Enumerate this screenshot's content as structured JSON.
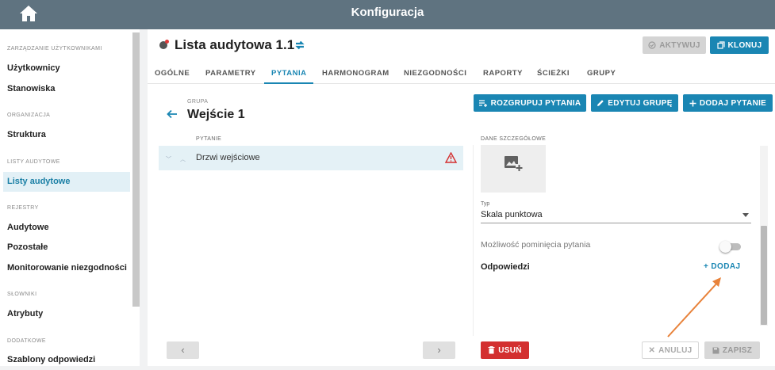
{
  "header": {
    "title": "Konfiguracja",
    "home_icon": "home-icon"
  },
  "sidebar": {
    "sections": [
      {
        "title": "ZARZĄDZANIE UŻYTKOWNIKAMI",
        "items": [
          {
            "label": "Użytkownicy"
          },
          {
            "label": "Stanowiska"
          }
        ]
      },
      {
        "title": "ORGANIZACJA",
        "items": [
          {
            "label": "Struktura"
          }
        ]
      },
      {
        "title": "LISTY AUDYTOWE",
        "items": [
          {
            "label": "Listy audytowe",
            "active": true
          }
        ]
      },
      {
        "title": "REJESTRY",
        "items": [
          {
            "label": "Audytowe"
          },
          {
            "label": "Pozostałe"
          },
          {
            "label": "Monitorowanie niezgodności"
          }
        ]
      },
      {
        "title": "SŁOWNIKI",
        "items": [
          {
            "label": "Atrybuty"
          }
        ]
      },
      {
        "title": "DODATKOWE",
        "items": [
          {
            "label": "Szablony odpowiedzi"
          }
        ]
      }
    ]
  },
  "page": {
    "title": "Lista audytowa 1.1",
    "activate_label": "AKTYWUJ",
    "clone_label": "KLONUJ"
  },
  "tabs": [
    {
      "label": "OGÓLNE"
    },
    {
      "label": "PARAMETRY"
    },
    {
      "label": "PYTANIA",
      "active": true
    },
    {
      "label": "HARMONOGRAM"
    },
    {
      "label": "NIEZGODNOŚCI"
    },
    {
      "label": "RAPORTY"
    },
    {
      "label": "ŚCIEŻKI"
    },
    {
      "label": "GRUPY"
    }
  ],
  "group": {
    "label": "GRUPA",
    "name": "Wejście 1",
    "ungroup_label": "ROZGRUPUJ PYTANIA",
    "edit_label": "EDYTUJ GRUPĘ",
    "add_question_label": "DODAJ PYTANIE"
  },
  "questions": {
    "column_header": "PYTANIE",
    "rows": [
      {
        "text": "Drzwi wejściowe",
        "warning": true
      }
    ]
  },
  "pager": {
    "prev": "‹",
    "next": "›"
  },
  "details": {
    "header": "DANE SZCZEGÓŁOWE",
    "type_label": "Typ",
    "type_value": "Skala punktowa",
    "skip_label": "Możliwość pominięcia pytania",
    "skip_enabled": false,
    "answers_label": "Odpowiedzi",
    "add_answer_label": "DODAJ",
    "delete_label": "USUŃ",
    "cancel_label": "ANULUJ",
    "save_label": "ZAPISZ"
  },
  "colors": {
    "topbar": "#5f7380",
    "accent": "#1a86b3",
    "danger": "#d32f2f",
    "annotation_arrow": "#e8823a"
  }
}
